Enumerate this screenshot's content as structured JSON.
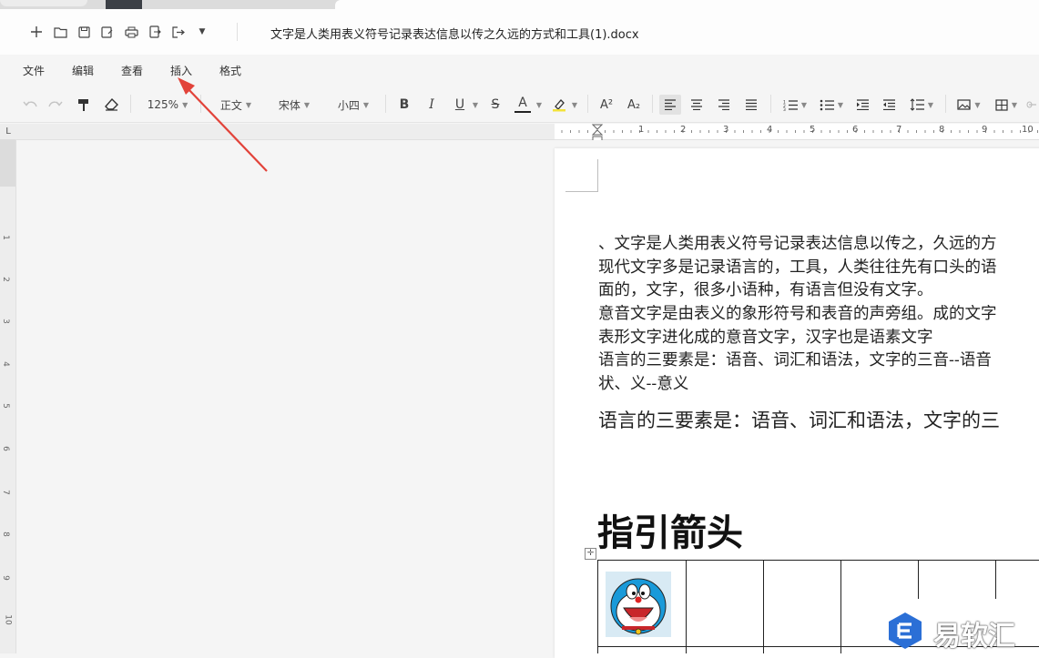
{
  "app": {
    "document_title": "文字是人类用表义符号记录表达信息以传之久远的方式和工具(1).docx"
  },
  "quick_access": {
    "icons": [
      "new-icon",
      "open-folder-icon",
      "save-icon",
      "save-as-icon",
      "print-icon",
      "export-icon",
      "share-icon",
      "more-dropdown-icon"
    ]
  },
  "menu": {
    "items": [
      "文件",
      "编辑",
      "查看",
      "插入",
      "格式"
    ]
  },
  "toolbar": {
    "zoom": "125%",
    "style": "正文",
    "font_family": "宋体",
    "font_size": "小四",
    "bold": "B",
    "italic": "I",
    "underline": "U",
    "strike": "S",
    "font_color_letter": "A",
    "superscript": "A²",
    "subscript": "A₂"
  },
  "ruler": {
    "numbers": [
      "1",
      "2",
      "3",
      "4",
      "5",
      "6",
      "7",
      "8",
      "9",
      "10"
    ],
    "vertical_numbers": [
      "1",
      "2",
      "3",
      "4",
      "5",
      "6",
      "7",
      "8",
      "9",
      "10"
    ],
    "corner_label": "L"
  },
  "document": {
    "paragraphs": [
      "、文字是人类用表义符号记录表达信息以传之，久远的方",
      "现代文字多是记录语言的，工具，人类往往先有口头的语",
      "面的，文字，很多小语种，有语言但没有文字。",
      "意音文字是由表义的象形符号和表音的声旁组。成的文字",
      "表形文字进化成的意音文字，汉字也是语素文字",
      "语言的三要素是：语音、词汇和语法，文字的三音--语音",
      "状、义--意义"
    ],
    "large_paragraph": "语言的三要素是：语音、词汇和语法，文字的三",
    "heading": "指引箭头"
  },
  "watermark": {
    "brand": "易软汇"
  },
  "colors": {
    "annotation_arrow": "#e2433a",
    "brand_blue": "#2b6fd6"
  }
}
